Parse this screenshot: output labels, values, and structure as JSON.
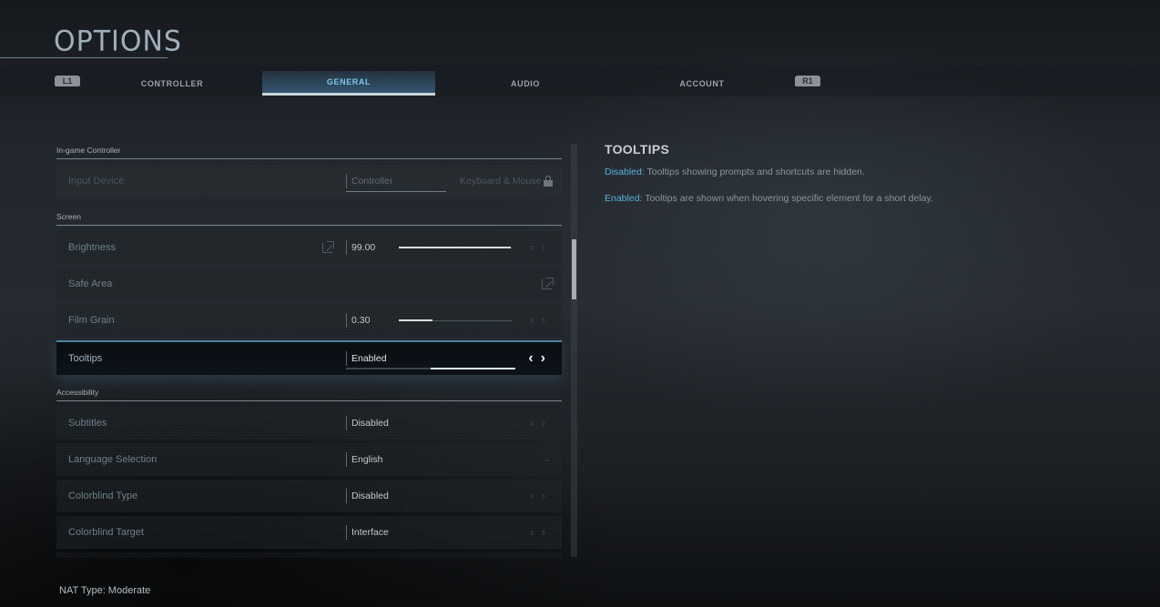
{
  "header": {
    "title": "OPTIONS",
    "bumper_left": "L1",
    "bumper_right": "R1",
    "tabs": [
      {
        "label": "CONTROLLER",
        "active": false
      },
      {
        "label": "GENERAL",
        "active": true
      },
      {
        "label": "AUDIO",
        "active": false
      },
      {
        "label": "ACCOUNT",
        "active": false
      }
    ]
  },
  "sections": {
    "in_game_controller": {
      "label": "In-game Controller",
      "input_device": {
        "label": "Input Device",
        "options": [
          "Controller",
          "Keyboard & Mouse"
        ],
        "selected": "Controller",
        "locked_option": "Keyboard & Mouse"
      }
    },
    "screen": {
      "label": "Screen",
      "brightness": {
        "label": "Brightness",
        "value": "99.00",
        "slider_fraction": 0.99
      },
      "safe_area": {
        "label": "Safe Area"
      },
      "film_grain": {
        "label": "Film Grain",
        "value": "0.30",
        "slider_fraction": 0.3
      },
      "tooltips": {
        "label": "Tooltips",
        "value": "Enabled",
        "selected": true,
        "option_index": 1,
        "option_count": 2
      }
    },
    "accessibility": {
      "label": "Accessibility",
      "subtitles": {
        "label": "Subtitles",
        "value": "Disabled"
      },
      "language": {
        "label": "Language Selection",
        "value": "English"
      },
      "colorblind_type": {
        "label": "Colorblind Type",
        "value": "Disabled"
      },
      "colorblind_target": {
        "label": "Colorblind Target",
        "value": "Interface"
      }
    }
  },
  "arrows": {
    "left": "‹",
    "right": "›",
    "down": "⌄"
  },
  "info_panel": {
    "title": "TOOLTIPS",
    "lines": [
      {
        "keyword": "Disabled",
        "text": ": Tooltips showing prompts and shortcuts are hidden."
      },
      {
        "keyword": "Enabled",
        "text": ": Tooltips are shown when hovering specific element for a short delay."
      }
    ]
  },
  "scroll": {
    "position_fraction": 0.27
  },
  "footer": {
    "nat_type": "NAT Type: Moderate"
  },
  "colors": {
    "accent": "#5ab1d8",
    "active_tab_text": "#7fc6e6"
  }
}
